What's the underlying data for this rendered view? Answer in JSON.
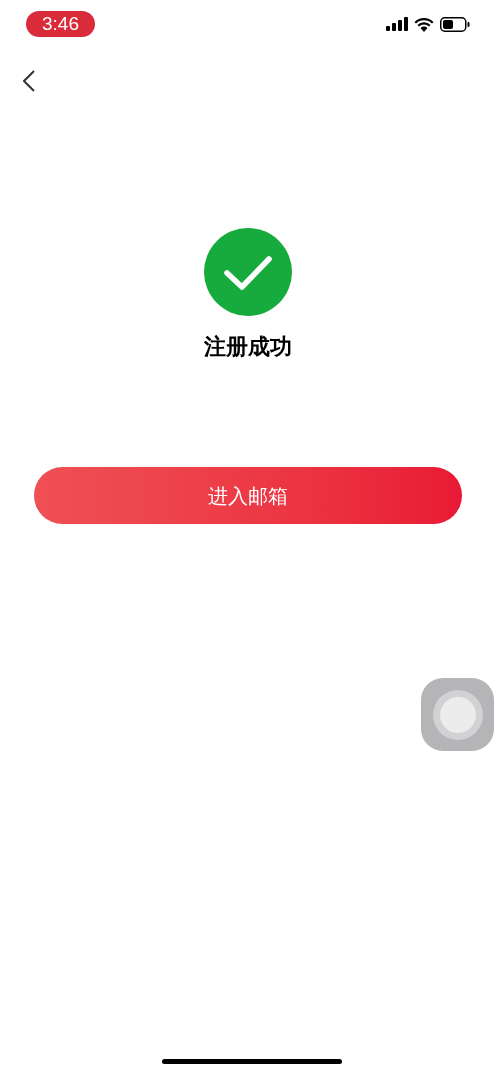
{
  "status_bar": {
    "time": "3:46"
  },
  "result": {
    "title": "注册成功"
  },
  "button": {
    "label": "进入邮箱"
  }
}
